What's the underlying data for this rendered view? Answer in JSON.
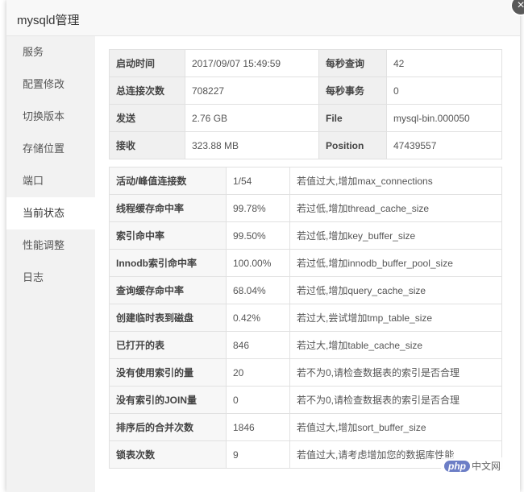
{
  "window": {
    "title": "mysqld管理",
    "close_glyph": "×"
  },
  "sidebar": {
    "items": [
      {
        "label": "服务"
      },
      {
        "label": "配置修改"
      },
      {
        "label": "切换版本"
      },
      {
        "label": "存储位置"
      },
      {
        "label": "端口"
      },
      {
        "label": "当前状态"
      },
      {
        "label": "性能调整"
      },
      {
        "label": "日志"
      }
    ],
    "active": "当前状态"
  },
  "status": {
    "rows": [
      {
        "l1": "启动时间",
        "v1": "2017/09/07 15:49:59",
        "l2": "每秒查询",
        "v2": "42"
      },
      {
        "l1": "总连接次数",
        "v1": "708227",
        "l2": "每秒事务",
        "v2": "0"
      },
      {
        "l1": "发送",
        "v1": "2.76 GB",
        "l2": "File",
        "v2": "mysql-bin.000050"
      },
      {
        "l1": "接收",
        "v1": "323.88 MB",
        "l2": "Position",
        "v2": "47439557"
      }
    ]
  },
  "perf": {
    "rows": [
      {
        "name": "活动/峰值连接数",
        "value": "1/54",
        "tip": "若值过大,增加max_connections"
      },
      {
        "name": "线程缓存命中率",
        "value": "99.78%",
        "tip": "若过低,增加thread_cache_size"
      },
      {
        "name": "索引命中率",
        "value": "99.50%",
        "tip": "若过低,增加key_buffer_size"
      },
      {
        "name": "Innodb索引命中率",
        "value": "100.00%",
        "tip": "若过低,增加innodb_buffer_pool_size"
      },
      {
        "name": "查询缓存命中率",
        "value": "68.04%",
        "tip": "若过低,增加query_cache_size"
      },
      {
        "name": "创建临时表到磁盘",
        "value": "0.42%",
        "tip": "若过大,尝试增加tmp_table_size"
      },
      {
        "name": "已打开的表",
        "value": "846",
        "tip": "若过大,增加table_cache_size"
      },
      {
        "name": "没有使用索引的量",
        "value": "20",
        "tip": "若不为0,请检查数据表的索引是否合理"
      },
      {
        "name": "没有索引的JOIN量",
        "value": "0",
        "tip": "若不为0,请检查数据表的索引是否合理"
      },
      {
        "name": "排序后的合并次数",
        "value": "1846",
        "tip": "若值过大,增加sort_buffer_size"
      },
      {
        "name": "锁表次数",
        "value": "9",
        "tip": "若值过大,请考虑增加您的数据库性能"
      }
    ]
  },
  "watermark": {
    "logo": "php",
    "text": "中文网"
  }
}
